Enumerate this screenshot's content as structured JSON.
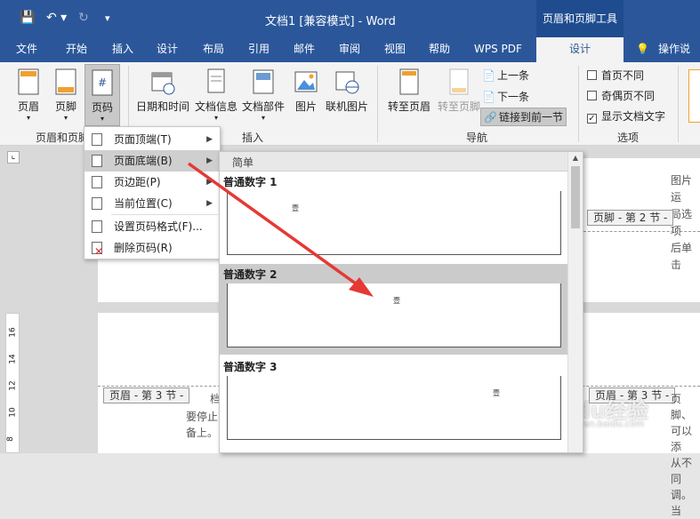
{
  "titlebar": {
    "title": "文档1 [兼容模式] - Word",
    "context_group": "页眉和页脚工具"
  },
  "tabs": [
    "文件",
    "开始",
    "插入",
    "设计",
    "布局",
    "引用",
    "邮件",
    "审阅",
    "视图",
    "帮助",
    "WPS PDF",
    "设计"
  ],
  "tell_me": "操作说明",
  "ribbon": {
    "header_footer": {
      "header": "页眉",
      "footer": "页脚",
      "page_number": "页码",
      "group_label": "页眉和页脚"
    },
    "insert": {
      "datetime": "日期和时间",
      "docinfo": "文档信息",
      "quickparts": "文档部件",
      "picture": "图片",
      "online_picture": "联机图片",
      "group_label": "插入"
    },
    "navigation": {
      "goto_header": "转至页眉",
      "goto_footer": "转至页脚",
      "previous": "上一条",
      "next": "下一条",
      "link_previous": "链接到前一节",
      "group_label": "导航"
    },
    "options": {
      "diff_first": "首页不同",
      "diff_odd_even": "奇偶页不同",
      "show_text": "显示文档文字",
      "group_label": "选项"
    }
  },
  "menu": {
    "items": [
      {
        "label": "页面顶端(T)"
      },
      {
        "label": "页面底端(B)"
      },
      {
        "label": "页边距(P)"
      },
      {
        "label": "当前位置(C)"
      },
      {
        "label": "设置页码格式(F)..."
      },
      {
        "label": "删除页码(R)"
      }
    ]
  },
  "gallery": {
    "section": "简单",
    "items": [
      {
        "label": "普通数字 1",
        "num": "壹"
      },
      {
        "label": "普通数字 2",
        "num": "壹"
      },
      {
        "label": "普通数字 3",
        "num": "壹"
      }
    ]
  },
  "document": {
    "tag_footer_2": "页脚 - 第 2 节 -",
    "tag_header_3_left": "页眉 - 第 3 节 -",
    "tag_header_3_right": "页眉 - 第 3 节 -",
    "text_right_1": "图片运",
    "text_right_2": "局选项",
    "text_right_3": "后单击",
    "text_left_1": "档",
    "text_left_2": "要停止",
    "text_left_3": "备上。",
    "text_right_4": "页脚、",
    "text_right_5": "可以添",
    "text_right_6": "从不同",
    "text_right_7": "调。当",
    "ruler_nums": [
      "16",
      "14",
      "12",
      "10",
      "8"
    ]
  },
  "watermark": {
    "brand": "Baidu经验",
    "url": "jingyan.baidu.com"
  }
}
